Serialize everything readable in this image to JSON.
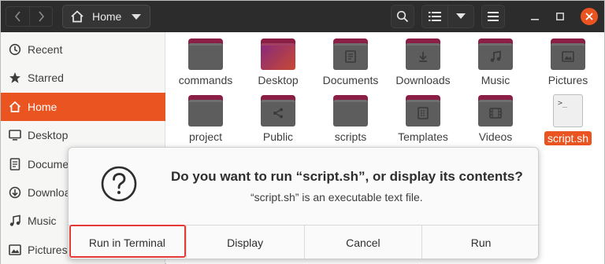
{
  "header": {
    "path_label": "Home",
    "back_icon": "chevron-left-icon",
    "forward_icon": "chevron-right-icon"
  },
  "sidebar": {
    "items": [
      {
        "label": "Recent",
        "icon": "clock-icon"
      },
      {
        "label": "Starred",
        "icon": "star-icon"
      },
      {
        "label": "Home",
        "icon": "home-icon"
      },
      {
        "label": "Desktop",
        "icon": "desktop-icon"
      },
      {
        "label": "Docume",
        "icon": "document-icon"
      },
      {
        "label": "Downloa",
        "icon": "download-icon"
      },
      {
        "label": "Music",
        "icon": "music-icon"
      },
      {
        "label": "Pictures",
        "icon": "picture-icon"
      }
    ],
    "active_index": 2
  },
  "files": [
    {
      "name": "commands",
      "emblem": ""
    },
    {
      "name": "Desktop",
      "emblem": ""
    },
    {
      "name": "Documents",
      "emblem": "document"
    },
    {
      "name": "Downloads",
      "emblem": "download"
    },
    {
      "name": "Music",
      "emblem": "music"
    },
    {
      "name": "Pictures",
      "emblem": "picture"
    },
    {
      "name": "project",
      "emblem": ""
    },
    {
      "name": "Public",
      "emblem": "share"
    },
    {
      "name": "scripts",
      "emblem": ""
    },
    {
      "name": "Templates",
      "emblem": "template"
    },
    {
      "name": "Videos",
      "emblem": "video"
    },
    {
      "name": "script.sh",
      "emblem": "",
      "selected": true
    }
  ],
  "dialog": {
    "title": "Do you want to run “script.sh”, or display its contents?",
    "subtitle": "“script.sh” is an executable text file.",
    "buttons": [
      "Run in Terminal",
      "Display",
      "Cancel",
      "Run"
    ]
  },
  "colors": {
    "accent": "#e95420",
    "header_bg": "#2c2c2c",
    "folder_body": "#5d5d5d",
    "folder_tab": "#8a1e45",
    "highlight_border": "#e53935"
  }
}
